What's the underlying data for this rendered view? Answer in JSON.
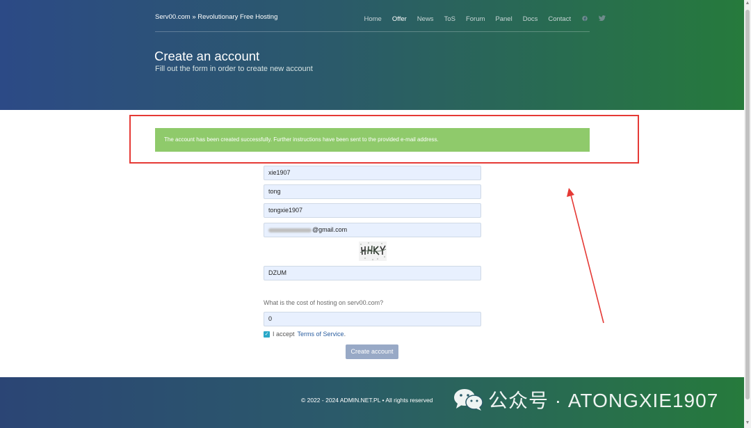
{
  "header": {
    "brand": "Serv00.com » Revolutionary Free Hosting",
    "nav": [
      {
        "label": "Home",
        "active": false
      },
      {
        "label": "Offer",
        "active": true
      },
      {
        "label": "News",
        "active": false
      },
      {
        "label": "ToS",
        "active": false
      },
      {
        "label": "Forum",
        "active": false
      },
      {
        "label": "Panel",
        "active": false
      },
      {
        "label": "Docs",
        "active": false
      },
      {
        "label": "Contact",
        "active": false
      }
    ],
    "social_icons": [
      "facebook-icon",
      "twitter-icon"
    ],
    "title": "Create an account",
    "subtitle": "Fill out the form in order to create new account"
  },
  "alert": {
    "message": "The account has been created successfully. Further instructions have been sent to the provided e-mail address."
  },
  "form": {
    "first_field_value": "xie1907",
    "second_field_value": "tong",
    "username_value": "tongxie1907",
    "email_value": "@gmail.com",
    "captcha_image": "captcha-image",
    "captcha_value": "DZUM",
    "question_label": "What is the cost of hosting on serv00.com?",
    "answer_value": "0",
    "accept_prefix": "I accept",
    "tos_link": "Terms of Service",
    "accept_suffix": ".",
    "terms_checked": true,
    "submit_label": "Create account"
  },
  "footer": {
    "copyright": "© 2022 - 2024 ADMIN.NET.PL • All rights reserved"
  },
  "watermark": {
    "text": "公众号 · ATONGXIE1907",
    "icon": "wechat-icon"
  },
  "colors": {
    "alert_green": "#8fca6b",
    "annotation_red": "#e53935",
    "button_blue": "#98a9c6"
  }
}
